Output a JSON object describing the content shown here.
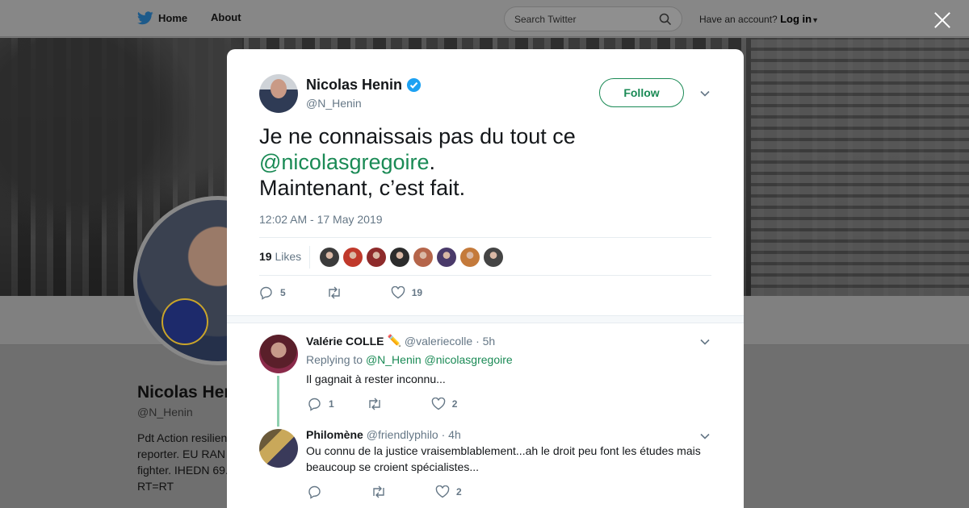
{
  "topbar": {
    "home_label": "Home",
    "about_label": "About",
    "search_placeholder": "Search Twitter",
    "account_prompt": "Have an account?",
    "login_label": "Log in"
  },
  "profile": {
    "name": "Nicolas Henin",
    "handle": "@N_Henin",
    "bio_lines": [
      "Pdt Action resilien",
      "reporter. EU RAN",
      "fighter. IHEDN 69.",
      "RT=RT"
    ]
  },
  "tweet": {
    "author_name": "Nicolas Henin",
    "author_handle": "@N_Henin",
    "follow_label": "Follow",
    "text_part1": "Je ne connaissais pas du tout ce",
    "mention": "@nicolasgregoire",
    "text_part2": ".",
    "text_part3": "Maintenant, c’est fait.",
    "timestamp": "12:02 AM - 17 May 2019",
    "likes_count": "19",
    "likes_label": "Likes",
    "reply_count": "5",
    "retweet_count": "",
    "like_count": "19",
    "liker_colors": [
      "#3b3b3b",
      "#c0392b",
      "#8e2b2b",
      "#2c2c2c",
      "#b5654a",
      "#4a3a6a",
      "#c47a3b",
      "#444444"
    ]
  },
  "replies": [
    {
      "name": "Valérie COLLE",
      "emoji": "✏️",
      "handle": "@valeriecolle",
      "time": "· 5h",
      "replying_prefix": "Replying to",
      "replying_to": "@N_Henin @nicolasgregoire",
      "text": "Il gagnait à rester inconnu...",
      "reply_count": "1",
      "retweet_count": "",
      "like_count": "2"
    },
    {
      "name": "Philomène",
      "handle": "@friendlyphilo",
      "time": "· 4h",
      "text": "Ou connu de la justice vraisemblablement...ah le droit peu font les études mais beaucoup se croient spécialistes...",
      "reply_count": "",
      "retweet_count": "",
      "like_count": "2"
    }
  ],
  "colors": {
    "accent": "#1a8a55",
    "verified": "#1da1f2",
    "secondary_text": "#657786",
    "thread_line": "#8fd0b0"
  }
}
